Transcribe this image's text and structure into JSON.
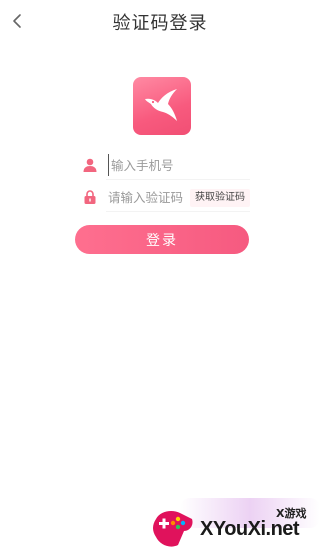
{
  "header": {
    "title": "验证码登录"
  },
  "icons": {
    "back": "chevron-left-icon",
    "logo": "hummingbird-logo",
    "phone": "user-icon",
    "code": "lock-icon"
  },
  "form": {
    "phone_placeholder": "输入手机号",
    "code_placeholder": "请输入验证码",
    "get_code_label": "获取验证码",
    "login_label": "登录"
  },
  "watermark": {
    "name_cn": "X游戏",
    "name": "XYouXi.net"
  },
  "colors": {
    "accent": "#f85a7e",
    "accent_light": "#fe6f8f"
  }
}
